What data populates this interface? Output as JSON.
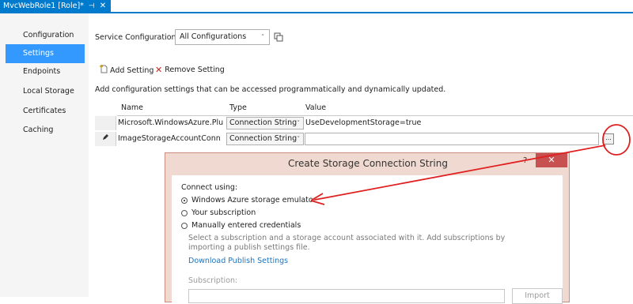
{
  "tab": {
    "title": "MvcWebRole1 [Role]*",
    "pin_glyph": "⊣",
    "close_glyph": "✕"
  },
  "sidebar": {
    "items": [
      {
        "label": "Configuration",
        "active": false
      },
      {
        "label": "Settings",
        "active": true
      },
      {
        "label": "Endpoints",
        "active": false
      },
      {
        "label": "Local Storage",
        "active": false
      },
      {
        "label": "Certificates",
        "active": false
      },
      {
        "label": "Caching",
        "active": false
      }
    ]
  },
  "service_config": {
    "label": "Service Configuration:",
    "selected": "All Configurations",
    "arrow": "˅"
  },
  "toolbar": {
    "add_label": "Add Setting",
    "remove_label": "Remove Setting"
  },
  "description": "Add configuration settings that can be accessed programmatically and dynamically updated.",
  "grid": {
    "columns": [
      "Name",
      "Type",
      "Value"
    ],
    "rows": [
      {
        "name": "Microsoft.WindowsAzure.Plu...",
        "type": "Connection String",
        "value": "UseDevelopmentStorage=true",
        "editing": false
      },
      {
        "name": "ImageStorageAccountConn",
        "type": "Connection String",
        "value": "",
        "editing": true
      }
    ],
    "ellipsis": "..."
  },
  "dialog": {
    "title": "Create Storage Connection String",
    "help": "?",
    "close": "✕",
    "connect_label": "Connect using:",
    "options": [
      {
        "label": "Windows Azure storage emulator",
        "selected": true
      },
      {
        "label": "Your subscription",
        "selected": false
      },
      {
        "label": "Manually entered credentials",
        "selected": false
      }
    ],
    "hint": "Select a subscription and a storage account associated with it. Add subscriptions by importing a publish settings file.",
    "link": "Download Publish Settings",
    "subscription_label": "Subscription:",
    "import_label": "Import"
  },
  "colors": {
    "accent": "#007acc",
    "selection": "#3399ff",
    "annotation": "#e02020"
  }
}
